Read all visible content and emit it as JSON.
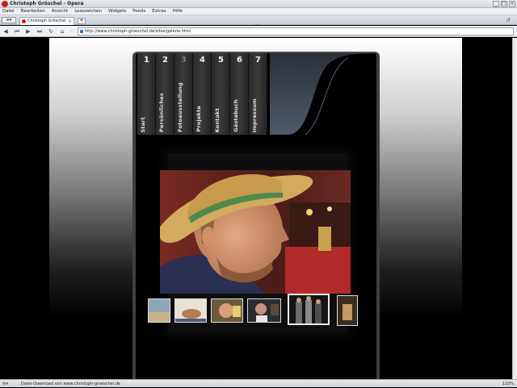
{
  "window": {
    "title": "Christoph Gröschel - Opera"
  },
  "menu": [
    "Datei",
    "Bearbeiten",
    "Ansicht",
    "Lesezeichen",
    "Widgets",
    "Feeds",
    "Extras",
    "Hilfe"
  ],
  "tabs": [
    {
      "label": "Christoph Gröschel"
    }
  ],
  "address": {
    "url": "http://www.christoph-groeschel.de/sites/galerie.html"
  },
  "nav": {
    "items": [
      {
        "num": "1",
        "label": "Start"
      },
      {
        "num": "2",
        "label": "Persönliches"
      },
      {
        "num": "3",
        "label": "Fotoausstellung"
      },
      {
        "num": "4",
        "label": "Projekte"
      },
      {
        "num": "5",
        "label": "Kontakt"
      },
      {
        "num": "6",
        "label": "Gästebuch"
      },
      {
        "num": "7",
        "label": "Impressum"
      }
    ],
    "active_index": 2
  },
  "status": {
    "text": "Datei-Download von www.christoph-groeschel.de",
    "zoom": "110%"
  },
  "colors": {
    "accent": "#6e7e90",
    "wave": "#4a5565",
    "opera_red": "#cc1a1a"
  }
}
